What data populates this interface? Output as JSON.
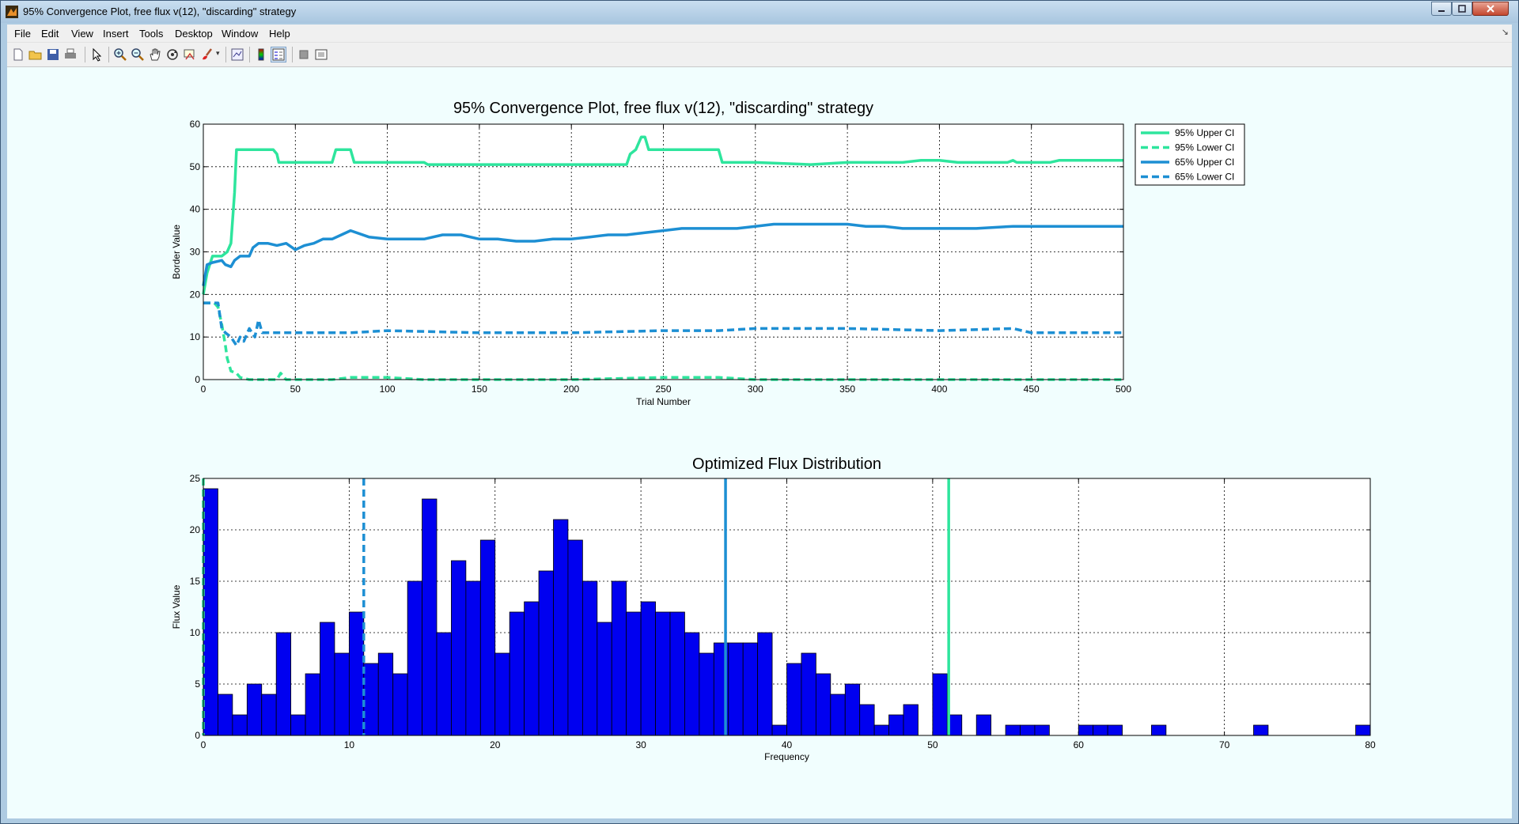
{
  "window": {
    "title": "95% Convergence Plot, free flux v(12), \"discarding\" strategy"
  },
  "menu": {
    "file": "File",
    "edit": "Edit",
    "view": "View",
    "insert": "Insert",
    "tools": "Tools",
    "desktop": "Desktop",
    "window": "Window",
    "help": "Help"
  },
  "toolbar_icons": [
    "new-figure-icon",
    "open-file-icon",
    "save-icon",
    "print-icon",
    "edit-plot-arrow-icon",
    "zoom-in-icon",
    "zoom-out-icon",
    "pan-hand-icon",
    "rotate-3d-icon",
    "data-cursor-icon",
    "brush-icon",
    "link-plot-icon",
    "colorbar-icon",
    "legend-icon",
    "hide-plot-tools-icon",
    "show-plot-tools-icon"
  ],
  "colors": {
    "green": "#2ee59d",
    "blue": "#1d8fd3",
    "bar": "#0000f0",
    "background": "#f1fefe"
  },
  "chart_data": [
    {
      "type": "line",
      "title": "95% Convergence Plot, free flux v(12), \"discarding\" strategy",
      "xlabel": "Trial Number",
      "ylabel": "Border Value",
      "xlim": [
        0,
        500
      ],
      "ylim": [
        0,
        60
      ],
      "xticks": [
        0,
        50,
        100,
        150,
        200,
        250,
        300,
        350,
        400,
        450,
        500
      ],
      "yticks": [
        0,
        10,
        20,
        30,
        40,
        50,
        60
      ],
      "grid": true,
      "legend_position": "outside-right",
      "series": [
        {
          "name": "95% Upper CI",
          "color": "#2ee59d",
          "style": "solid",
          "x": [
            0,
            2,
            5,
            10,
            13,
            15,
            17,
            18,
            20,
            25,
            30,
            38,
            40,
            41,
            45,
            50,
            60,
            70,
            72,
            80,
            82,
            90,
            100,
            110,
            120,
            122,
            150,
            200,
            230,
            232,
            235,
            238,
            240,
            242,
            250,
            260,
            270,
            280,
            282,
            300,
            330,
            350,
            380,
            390,
            400,
            410,
            420,
            437,
            440,
            442,
            450,
            460,
            465,
            470,
            480,
            500
          ],
          "y": [
            20,
            25,
            29,
            29,
            30,
            32,
            44,
            54,
            54,
            54,
            54,
            54,
            53,
            51,
            51,
            51,
            51,
            51,
            54,
            54,
            51,
            51,
            51,
            51,
            51,
            50.5,
            50.5,
            50.5,
            50.5,
            53,
            54,
            57,
            57,
            54,
            54,
            54,
            54,
            54,
            51,
            51,
            50.5,
            51,
            51,
            51.5,
            51.5,
            51,
            51,
            51,
            51.5,
            51,
            51,
            51,
            51.5,
            51.5,
            51.5,
            51.5
          ]
        },
        {
          "name": "95% Lower CI",
          "color": "#2ee59d",
          "style": "dashed",
          "x": [
            0,
            3,
            6,
            8,
            10,
            12,
            13,
            15,
            18,
            20,
            25,
            40,
            42,
            45,
            50,
            70,
            80,
            100,
            120,
            200,
            250,
            280,
            300,
            500
          ],
          "y": [
            18,
            18,
            18,
            17,
            13,
            8,
            5,
            2,
            1.5,
            0.5,
            0,
            0,
            1.5,
            0,
            0,
            0,
            0.5,
            0.5,
            0,
            0,
            0.5,
            0.5,
            0,
            0
          ]
        },
        {
          "name": "65% Upper CI",
          "color": "#1d8fd3",
          "style": "solid",
          "x": [
            0,
            2,
            5,
            10,
            12,
            15,
            17,
            20,
            25,
            27,
            30,
            35,
            40,
            45,
            50,
            55,
            60,
            65,
            70,
            75,
            80,
            90,
            100,
            110,
            120,
            130,
            140,
            150,
            160,
            170,
            180,
            190,
            200,
            210,
            220,
            230,
            240,
            250,
            260,
            270,
            280,
            290,
            300,
            310,
            320,
            330,
            340,
            350,
            360,
            370,
            380,
            390,
            400,
            420,
            440,
            460,
            480,
            500
          ],
          "y": [
            22,
            27,
            27.5,
            28,
            27,
            26.5,
            28,
            29,
            29,
            31,
            32,
            32,
            31.5,
            32,
            30.5,
            31.5,
            32,
            33,
            33,
            34,
            35,
            33.5,
            33,
            33,
            33,
            34,
            34,
            33,
            33,
            32.5,
            32.5,
            33,
            33,
            33.5,
            34,
            34,
            34.5,
            35,
            35.5,
            35.5,
            35.5,
            35.5,
            36,
            36.5,
            36.5,
            36.5,
            36.5,
            36.5,
            36,
            36,
            35.5,
            35.5,
            35.5,
            35.5,
            36,
            36,
            36,
            36
          ]
        },
        {
          "name": "65% Lower CI",
          "color": "#1d8fd3",
          "style": "dashed",
          "x": [
            0,
            2,
            5,
            8,
            10,
            12,
            15,
            18,
            20,
            22,
            25,
            28,
            30,
            32,
            35,
            40,
            50,
            80,
            100,
            150,
            200,
            250,
            280,
            300,
            350,
            400,
            440,
            450,
            500
          ],
          "y": [
            18,
            18,
            18,
            18,
            12,
            11,
            10,
            8,
            10,
            9,
            12,
            10,
            14,
            11,
            11,
            11,
            11,
            11,
            11.5,
            11,
            11,
            11.5,
            11.5,
            12,
            12,
            11.5,
            12,
            11,
            11
          ]
        }
      ]
    },
    {
      "type": "bar",
      "title": "Optimized Flux Distribution",
      "xlabel": "Frequency",
      "ylabel": "Flux Value",
      "xlim": [
        0,
        80
      ],
      "ylim": [
        0,
        25
      ],
      "xticks": [
        0,
        10,
        20,
        30,
        40,
        50,
        60,
        70,
        80
      ],
      "yticks": [
        0,
        5,
        10,
        15,
        20,
        25
      ],
      "grid": true,
      "bin_width": 1,
      "bin_start": 0,
      "values": [
        24,
        4,
        2,
        5,
        4,
        10,
        2,
        6,
        11,
        8,
        12,
        7,
        8,
        6,
        15,
        23,
        10,
        17,
        15,
        19,
        8,
        12,
        13,
        16,
        21,
        19,
        15,
        11,
        15,
        12,
        13,
        12,
        12,
        10,
        8,
        9,
        9,
        9,
        10,
        1,
        7,
        8,
        6,
        4,
        5,
        3,
        1,
        2,
        3,
        0,
        6,
        2,
        0,
        2,
        0,
        1,
        1,
        1,
        0,
        0,
        1,
        1,
        1,
        0,
        0,
        1,
        0,
        0,
        0,
        0,
        0,
        0,
        1,
        0,
        0,
        0,
        0,
        0,
        0,
        1
      ],
      "vertical_lines": [
        {
          "x": 0,
          "color": "#2ee59d",
          "style": "dashed"
        },
        {
          "x": 11,
          "color": "#1d8fd3",
          "style": "dashed"
        },
        {
          "x": 35.8,
          "color": "#1d8fd3",
          "style": "solid"
        },
        {
          "x": 51.1,
          "color": "#2ee59d",
          "style": "solid"
        }
      ]
    }
  ]
}
